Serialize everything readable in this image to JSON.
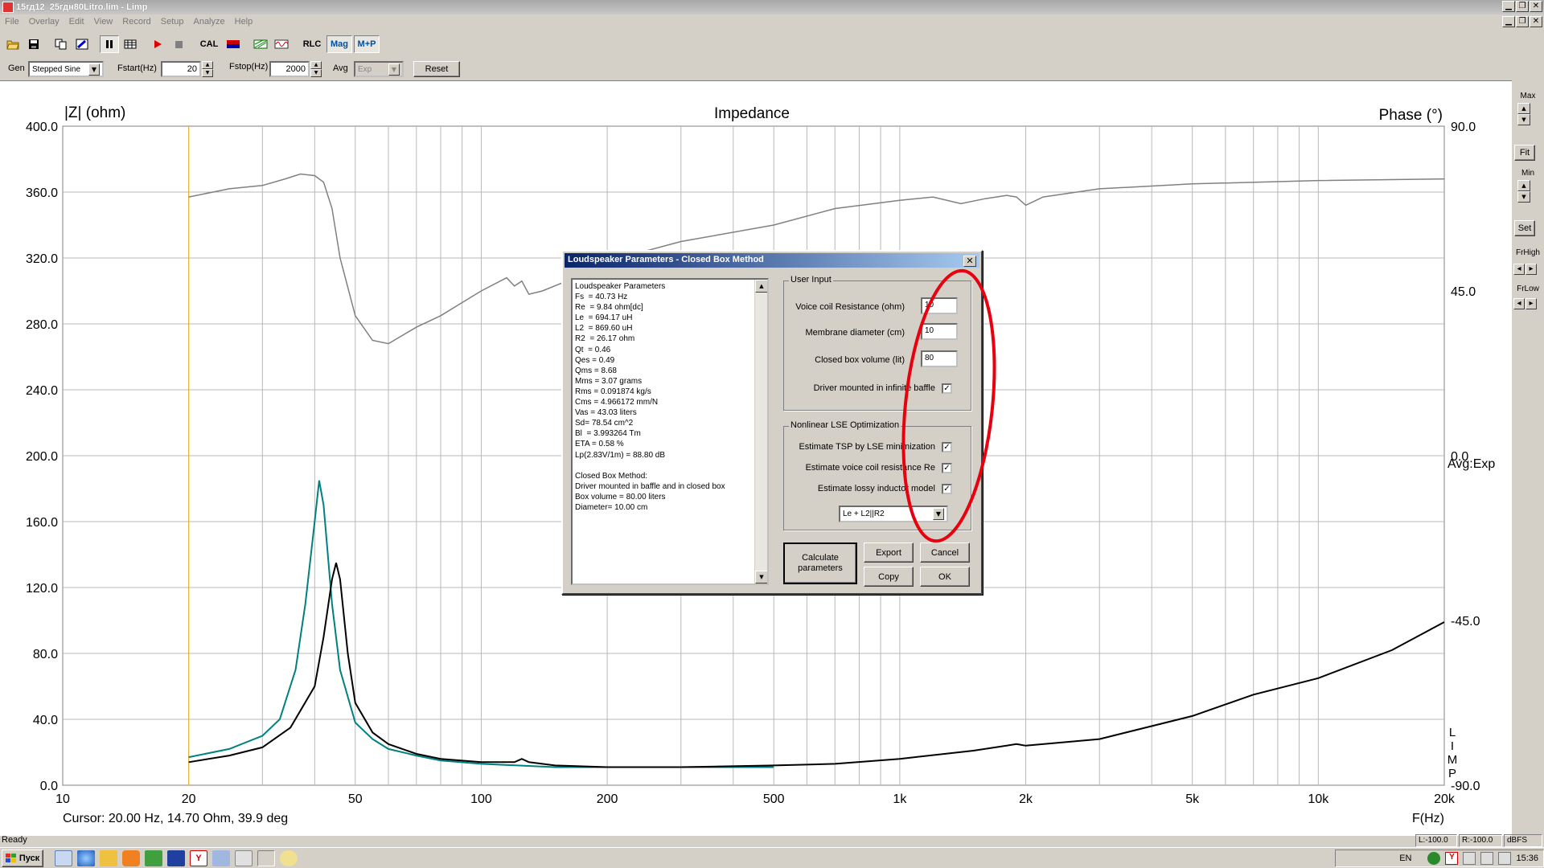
{
  "window": {
    "title": "15гд12_25гдн80Litro.lim - Limp",
    "min": "▁",
    "restore": "❐",
    "close": "✕"
  },
  "menu": [
    "File",
    "Overlay",
    "Edit",
    "View",
    "Record",
    "Setup",
    "Analyze",
    "Help"
  ],
  "toolbar": {
    "cal": "CAL",
    "rlc": "RLC",
    "mag": "Mag",
    "mp": "M+P"
  },
  "params": {
    "gen_label": "Gen",
    "gen_value": "Stepped Sine",
    "fstart_label": "Fstart(Hz)",
    "fstart_value": "20",
    "fstop_label": "Fstop(Hz)",
    "fstop_value": "2000",
    "avg_label": "Avg",
    "avg_value": "Exp",
    "reset": "Reset"
  },
  "side": {
    "max": "Max",
    "fit": "Fit",
    "min": "Min",
    "set": "Set",
    "frhigh": "FrHigh",
    "frlow": "FrLow"
  },
  "plot": {
    "title": "Impedance",
    "left_axis_label": "|Z| (ohm)",
    "right_axis_label": "Phase (°)",
    "x_axis_label": "F(Hz)",
    "avg_label": "Avg:Exp",
    "limp_label": [
      "L",
      "I",
      "M",
      "P"
    ],
    "cursor": "Cursor: 20.00 Hz, 14.70 Ohm, 39.9 deg"
  },
  "chart_data": {
    "type": "line",
    "title": "Impedance",
    "xlabel": "F(Hz)",
    "ylabel": "|Z| (ohm)",
    "y2label": "Phase (°)",
    "x_scale": "log",
    "xlim": [
      10,
      20000
    ],
    "ylim": [
      0,
      400
    ],
    "y2lim": [
      -90,
      90
    ],
    "x_ticks": [
      "10",
      "20",
      "50",
      "100",
      "200",
      "500",
      "1k",
      "2k",
      "5k",
      "10k",
      "20k"
    ],
    "y_ticks": [
      "400.0",
      "360.0",
      "320.0",
      "280.0",
      "240.0",
      "200.0",
      "160.0",
      "120.0",
      "80.0",
      "40.0",
      "0.0"
    ],
    "y2_ticks": [
      "90.0",
      "45.0",
      "0.0",
      "-45.0",
      "-90.0"
    ],
    "grid": true,
    "series": [
      {
        "color": "#808080",
        "x": [
          20,
          25,
          30,
          34,
          37,
          40,
          42,
          44,
          46,
          50,
          55,
          60,
          70,
          80,
          100,
          115,
          120,
          125,
          130,
          140,
          160,
          200,
          300,
          500,
          700,
          1000,
          1200,
          1400,
          1600,
          1800,
          1900,
          2000,
          2200,
          3000,
          5000,
          10000,
          20000
        ],
        "y": [
          357,
          362,
          364,
          368,
          371,
          370,
          366,
          350,
          320,
          285,
          270,
          268,
          278,
          285,
          300,
          308,
          303,
          306,
          298,
          300,
          306,
          318,
          330,
          340,
          350,
          355,
          357,
          353,
          356,
          358,
          357,
          352,
          357,
          362,
          365,
          367,
          368
        ]
      },
      {
        "color": "#008080",
        "x": [
          20,
          25,
          30,
          33,
          36,
          38,
          40,
          41,
          42,
          44,
          46,
          50,
          55,
          60,
          70,
          80,
          100,
          150,
          200,
          500
        ],
        "y": [
          17,
          22,
          30,
          40,
          70,
          110,
          160,
          185,
          170,
          110,
          70,
          38,
          28,
          22,
          18,
          15,
          13,
          11,
          11,
          11
        ]
      },
      {
        "color": "#000000",
        "x": [
          20,
          25,
          30,
          35,
          40,
          42,
          44,
          45,
          46,
          48,
          50,
          55,
          60,
          70,
          80,
          100,
          110,
          120,
          125,
          130,
          150,
          200,
          300,
          500,
          700,
          1000,
          1500,
          1800,
          1900,
          2000,
          3000,
          5000,
          7000,
          10000,
          15000,
          20000
        ],
        "y": [
          14,
          18,
          23,
          35,
          60,
          90,
          125,
          135,
          125,
          80,
          50,
          32,
          25,
          19,
          16,
          14,
          14,
          14,
          16,
          14,
          12,
          11,
          11,
          12,
          13,
          16,
          21,
          24,
          25,
          24,
          28,
          42,
          55,
          65,
          82,
          99
        ]
      }
    ]
  },
  "dialog": {
    "title": "Loudspeaker Parameters - Closed Box Method",
    "close": "✕",
    "results": [
      "Loudspeaker Parameters",
      "Fs  = 40.73 Hz",
      "Re  = 9.84 ohm[dc]",
      "Le  = 694.17 uH",
      "L2  = 869.60 uH",
      "R2  = 26.17 ohm",
      "Qt  = 0.46",
      "Qes = 0.49",
      "Qms = 8.68",
      "Mms = 3.07 grams",
      "Rms = 0.091874 kg/s",
      "Cms = 4.966172 mm/N",
      "Vas = 43.03 liters",
      "Sd= 78.54 cm^2",
      "Bl  = 3.993264 Tm",
      "ETA = 0.58 %",
      "Lp(2.83V/1m) = 88.80 dB",
      "",
      "Closed Box Method:",
      "Driver mounted in baffle and in closed box",
      "Box volume = 80.00 liters",
      "Diameter= 10.00 cm"
    ],
    "user_input": {
      "group": "User Input",
      "vc_label": "Voice coil Resistance (ohm)",
      "vc_value": "10",
      "md_label": "Membrane diameter (cm)",
      "md_value": "10",
      "vol_label": "Closed box volume (lit)",
      "vol_value": "80",
      "baffle_label": "Driver mounted in infinite baffle"
    },
    "lse": {
      "group": "Nonlinear LSE Optimization",
      "tsp_label": "Estimate TSP by LSE minimization",
      "re_label": "Estimate voice coil resistance Re",
      "ind_label": "Estimate lossy inductor model",
      "model_value": "Le + L2||R2"
    },
    "buttons": {
      "calc": "Calculate parameters",
      "export": "Export",
      "cancel": "Cancel",
      "copy": "Copy",
      "ok": "OK"
    },
    "check": "✓"
  },
  "status": {
    "ready": "Ready",
    "l": "L:-100.0",
    "r": "R:-100.0",
    "dbfs": "dBFS"
  },
  "taskbar": {
    "start": "Пуск",
    "lang": "EN",
    "time": "15:36"
  }
}
